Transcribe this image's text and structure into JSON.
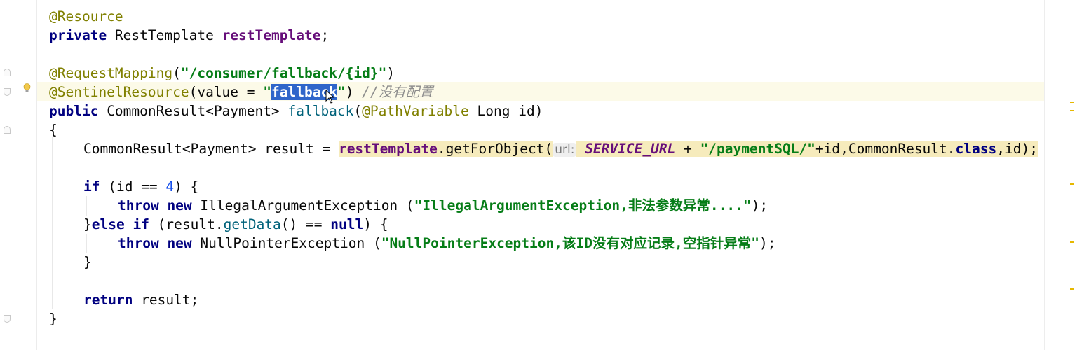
{
  "editor": {
    "lines": [
      {
        "id": "l1",
        "segments": [
          {
            "t": "@Resource",
            "c": "ann"
          }
        ]
      },
      {
        "id": "l2",
        "segments": [
          {
            "t": "private",
            "c": "kw"
          },
          {
            "t": " RestTemplate ",
            "c": ""
          },
          {
            "t": "restTemplate",
            "c": "field"
          },
          {
            "t": ";",
            "c": ""
          }
        ]
      },
      {
        "id": "l3",
        "segments": []
      },
      {
        "id": "l4",
        "segments": [
          {
            "t": "@RequestMapping",
            "c": "ann"
          },
          {
            "t": "(",
            "c": ""
          },
          {
            "t": "\"/consumer/fallback/{id}\"",
            "c": "str"
          },
          {
            "t": ")",
            "c": ""
          }
        ]
      },
      {
        "id": "l5",
        "segments": [
          {
            "t": "@SentinelResource",
            "c": "ann"
          },
          {
            "t": "(value = ",
            "c": ""
          },
          {
            "t": "\"",
            "c": "str"
          },
          {
            "t": "fallback",
            "c": "str sel"
          },
          {
            "t": "\"",
            "c": "str"
          },
          {
            "t": ") ",
            "c": ""
          },
          {
            "t": "//没有配置",
            "c": "cmt"
          }
        ]
      },
      {
        "id": "l6",
        "segments": [
          {
            "t": "public",
            "c": "kw"
          },
          {
            "t": " CommonResult<Payment> ",
            "c": ""
          },
          {
            "t": "fallback",
            "c": "method"
          },
          {
            "t": "(",
            "c": ""
          },
          {
            "t": "@PathVariable",
            "c": "ann"
          },
          {
            "t": " Long id)",
            "c": ""
          }
        ]
      },
      {
        "id": "l7",
        "segments": [
          {
            "t": "{",
            "c": ""
          }
        ]
      },
      {
        "id": "l8",
        "segments": [
          {
            "t": "CommonResult<Payment> result = ",
            "c": ""
          },
          {
            "t": "restTemplate",
            "c": "field warn-hl"
          },
          {
            "t": ".getForObject(",
            "c": "warn-hl"
          },
          {
            "t": "url:",
            "c": "hint"
          },
          {
            "t": " ",
            "c": "warn-hl"
          },
          {
            "t": "SERVICE_URL",
            "c": "static warn-hl"
          },
          {
            "t": " + ",
            "c": "warn-hl"
          },
          {
            "t": "\"/paymentSQL/\"",
            "c": "str warn-hl"
          },
          {
            "t": "+id,CommonResult.",
            "c": "warn-hl"
          },
          {
            "t": "class",
            "c": "kw warn-hl"
          },
          {
            "t": ",id);",
            "c": "warn-hl"
          }
        ]
      },
      {
        "id": "l9",
        "segments": []
      },
      {
        "id": "l10",
        "segments": [
          {
            "t": "if",
            "c": "kw"
          },
          {
            "t": " (id == ",
            "c": ""
          },
          {
            "t": "4",
            "c": "num"
          },
          {
            "t": ") {",
            "c": ""
          }
        ]
      },
      {
        "id": "l11",
        "segments": [
          {
            "t": "throw new",
            "c": "kw"
          },
          {
            "t": " IllegalArgumentException (",
            "c": ""
          },
          {
            "t": "\"IllegalArgumentException,非法参数异常....\"",
            "c": "str"
          },
          {
            "t": ");",
            "c": ""
          }
        ]
      },
      {
        "id": "l12",
        "segments": [
          {
            "t": "}",
            "c": ""
          },
          {
            "t": "else if",
            "c": "kw"
          },
          {
            "t": " (result.",
            "c": ""
          },
          {
            "t": "getData",
            "c": "method"
          },
          {
            "t": "() == ",
            "c": ""
          },
          {
            "t": "null",
            "c": "kw"
          },
          {
            "t": ") {",
            "c": ""
          }
        ]
      },
      {
        "id": "l13",
        "segments": [
          {
            "t": "throw new",
            "c": "kw"
          },
          {
            "t": " NullPointerException (",
            "c": ""
          },
          {
            "t": "\"NullPointerException,该ID没有对应记录,空指针异常\"",
            "c": "str"
          },
          {
            "t": ");",
            "c": ""
          }
        ]
      },
      {
        "id": "l14",
        "segments": [
          {
            "t": "}",
            "c": ""
          }
        ]
      },
      {
        "id": "l15",
        "segments": []
      },
      {
        "id": "l16",
        "segments": [
          {
            "t": "return",
            "c": "kw"
          },
          {
            "t": " result;",
            "c": ""
          }
        ]
      },
      {
        "id": "l17",
        "segments": [
          {
            "t": "}",
            "c": ""
          }
        ]
      }
    ]
  },
  "gutter": {
    "intention_icon": "lightbulb-icon"
  },
  "colors": {
    "keyword": "#000080",
    "annotation": "#808000",
    "string": "#067d17",
    "selection": "#2f65ca"
  }
}
